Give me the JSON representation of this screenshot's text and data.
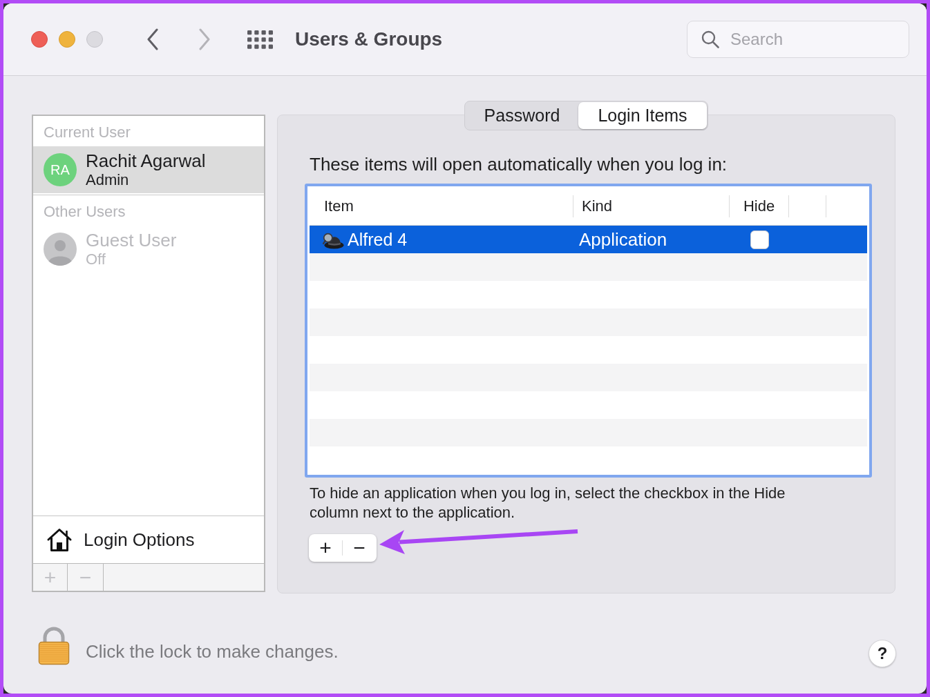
{
  "window": {
    "title": "Users & Groups",
    "controls": [
      {
        "kind": "close",
        "disabled": false
      },
      {
        "kind": "minimize",
        "disabled": false
      },
      {
        "kind": "zoom",
        "disabled": true
      }
    ]
  },
  "navigation": [
    {
      "kind": "back",
      "disabled": false
    },
    {
      "kind": "forward",
      "disabled": true
    }
  ],
  "search": {
    "placeholder": "Search"
  },
  "sidebar": {
    "sections": [
      {
        "heading": "Current User",
        "users": [
          {
            "kind": "initials",
            "initials": "RA",
            "name": "Rachit Agarwal",
            "role": "Admin",
            "selected": true,
            "disabled": false
          }
        ]
      },
      {
        "heading": "Other Users",
        "users": [
          {
            "kind": "silhouette",
            "name": "Guest User",
            "role": "Off",
            "selected": false,
            "disabled": true
          }
        ]
      }
    ],
    "login_options": {
      "label": "Login Options"
    },
    "buttons": [
      {
        "label": "+",
        "disabled": true
      },
      {
        "label": "−",
        "disabled": true
      }
    ]
  },
  "tabs": [
    {
      "label": "Password",
      "selected": false
    },
    {
      "label": "Login Items",
      "selected": true
    }
  ],
  "login_items": {
    "intro": "These items will open automatically when you log in:",
    "table": {
      "columns": [
        "Item",
        "Kind",
        "Hide"
      ],
      "rows": [
        {
          "cells": [
            "Alfred 4",
            "Application"
          ],
          "hidden": false,
          "selected": true
        }
      ]
    },
    "hint": "To hide an application when you log in, select the checkbox in the Hide column next to the application.",
    "buttons": [
      {
        "label": "+",
        "disabled": false
      },
      {
        "label": "−",
        "disabled": false
      }
    ]
  },
  "lock": {
    "message": "Click the lock to make changes.",
    "locked": true
  },
  "help_button": {
    "label": "?"
  }
}
